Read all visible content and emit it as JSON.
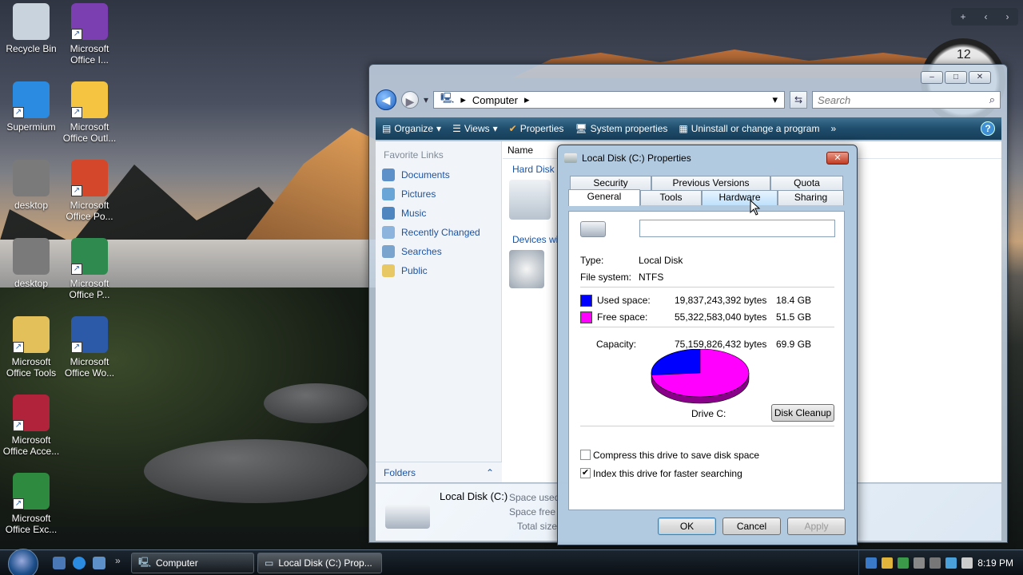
{
  "desktop": {
    "icons": [
      {
        "label": "Recycle Bin",
        "color": "#c8d3de"
      },
      {
        "label": "Microsoft Office I...",
        "color": "#7b3fb2"
      },
      {
        "label": "Supermium",
        "color": "#2b8be0"
      },
      {
        "label": "Microsoft Office Outl...",
        "color": "#f5c541"
      },
      {
        "label": "desktop",
        "color": "#7a7a7a"
      },
      {
        "label": "Microsoft Office Po...",
        "color": "#d5472b"
      },
      {
        "label": "desktop",
        "color": "#7a7a7a"
      },
      {
        "label": "Microsoft Office P...",
        "color": "#2f8a4f"
      },
      {
        "label": "Microsoft Office Tools",
        "color": "#e3c05a"
      },
      {
        "label": "Microsoft Office Wo...",
        "color": "#2c5aa8"
      },
      {
        "label": "Microsoft Office Acce...",
        "color": "#b1233a"
      },
      {
        "label": "Microsoft Office Exc...",
        "color": "#2e8a3e"
      }
    ],
    "clock_gadget": "12"
  },
  "explorer": {
    "address": "Computer",
    "search_placeholder": "Search",
    "toolbar": [
      "Organize",
      "Views",
      "Properties",
      "System properties",
      "Uninstall or change a program"
    ],
    "favorite_links_header": "Favorite Links",
    "favorite_links": [
      "Documents",
      "Pictures",
      "Music",
      "Recently Changed",
      "Searches",
      "Public"
    ],
    "folders_label": "Folders",
    "column_name": "Name",
    "group_hard_disk": "Hard Disk",
    "group_devices": "Devices wi",
    "details": {
      "title": "Local Disk (C:)",
      "labels": [
        "Space used",
        "Space free",
        "Total size"
      ]
    }
  },
  "dialog": {
    "title": "Local Disk (C:) Properties",
    "tabs_back": [
      "Security",
      "Previous Versions",
      "Quota"
    ],
    "tabs_front": [
      "General",
      "Tools",
      "Hardware",
      "Sharing"
    ],
    "active_tab": "General",
    "type_label": "Type:",
    "type_value": "Local Disk",
    "fs_label": "File system:",
    "fs_value": "NTFS",
    "used_label": "Used space:",
    "used_bytes": "19,837,243,392 bytes",
    "used_gb": "18.4 GB",
    "free_label": "Free space:",
    "free_bytes": "55,322,583,040 bytes",
    "free_gb": "51.5 GB",
    "capacity_label": "Capacity:",
    "capacity_bytes": "75,159,826,432 bytes",
    "capacity_gb": "69.9 GB",
    "used_color": "#0000ff",
    "free_color": "#ff00ff",
    "drive_label": "Drive C:",
    "disk_cleanup": "Disk Cleanup",
    "compress_label": "Compress this drive to save disk space",
    "compress_checked": false,
    "index_label": "Index this drive for faster searching",
    "index_checked": true,
    "ok": "OK",
    "cancel": "Cancel",
    "apply": "Apply"
  },
  "taskbar": {
    "buttons": [
      "Computer",
      "Local Disk (C:) Prop..."
    ],
    "time": "8:19 PM"
  }
}
